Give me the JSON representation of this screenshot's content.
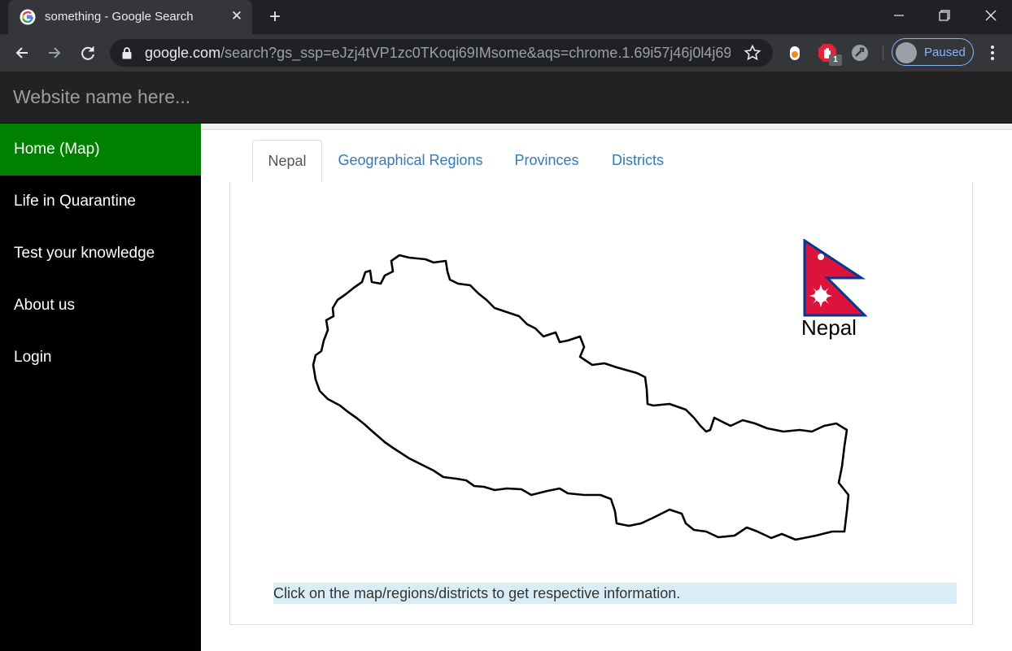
{
  "browser": {
    "tab_title": "something - Google Search",
    "url_host": "google.com",
    "url_path": "/search?gs_ssp=eJzj4tVP1zc0TKoqi69IMsome&aqs=chrome.1.69i57j46j0l4j69i60j...",
    "extension_badge": "1",
    "profile_label": "Paused",
    "icons": {
      "favicon": "google-favicon",
      "close": "close-icon",
      "new_tab": "plus-icon",
      "back": "arrow-left-icon",
      "forward": "arrow-right-icon",
      "reload": "reload-icon",
      "lock": "lock-icon",
      "star": "star-icon",
      "menu": "kebab-menu-icon"
    }
  },
  "site": {
    "brand": "Website name here...",
    "accent_color": "#008000",
    "sidebar": [
      {
        "label": "Home (Map)",
        "active": true
      },
      {
        "label": "Life in Quarantine",
        "active": false
      },
      {
        "label": "Test your knowledge",
        "active": false
      },
      {
        "label": "About us",
        "active": false
      },
      {
        "label": "Login",
        "active": false
      }
    ],
    "tabs": [
      {
        "label": "Nepal",
        "active": true
      },
      {
        "label": "Geographical Regions",
        "active": false
      },
      {
        "label": "Provinces",
        "active": false
      },
      {
        "label": "Districts",
        "active": false
      }
    ],
    "map": {
      "flag_label": "Nepal",
      "flag_colors": {
        "field": "#dc143c",
        "border": "#003893",
        "emblem": "#ffffff"
      }
    },
    "info_text": "Click on the map/regions/districts to get respective information."
  }
}
